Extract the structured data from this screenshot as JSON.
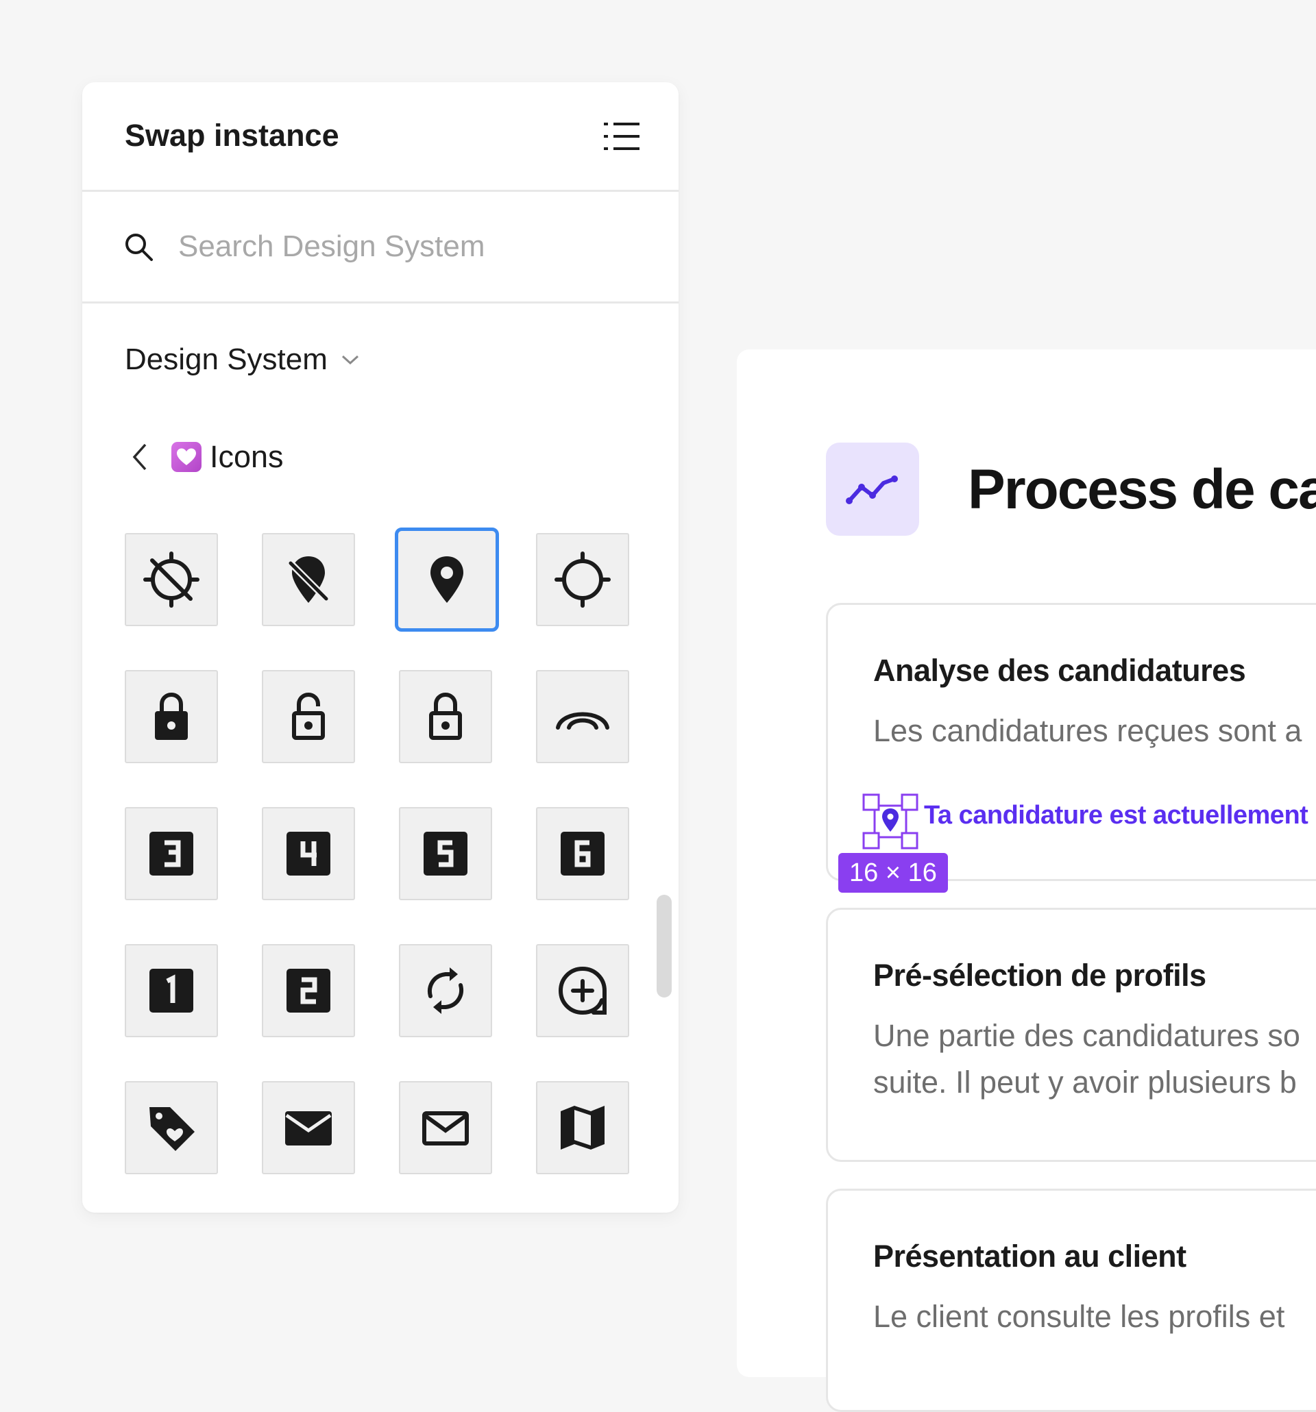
{
  "panel": {
    "title": "Swap instance",
    "list_view_icon": "list-view-icon",
    "search": {
      "icon": "search-icon",
      "placeholder": "Search Design System",
      "value": ""
    },
    "library": {
      "label": "Design System",
      "icon": "chevron-down-icon"
    },
    "category": {
      "back_icon": "chevron-left-icon",
      "emoji": "heart-emoji",
      "label": "Icons"
    },
    "icons": [
      [
        "location-disabled-icon",
        "location-off-icon",
        "location-pin-icon",
        "gps-target-icon"
      ],
      [
        "lock-icon",
        "lock-open-outline-icon",
        "lock-outline-icon",
        "signal-arc-icon"
      ],
      [
        "number-3-box-icon",
        "number-4-box-icon",
        "number-5-box-icon",
        "number-6-box-icon"
      ],
      [
        "number-1-box-icon",
        "number-2-box-icon",
        "sync-icon",
        "add-circle-icon"
      ],
      [
        "tag-heart-icon",
        "mail-filled-icon",
        "mail-outline-icon",
        "map-icon"
      ]
    ],
    "selected_icon": "location-pin-icon",
    "accent_color": "#3d8bf0"
  },
  "canvas": {
    "title": "Process de ca",
    "title_icon": "trending-line-icon",
    "steps": [
      {
        "title": "Analyse des candidatures",
        "description": "Les candidatures reçues sont a",
        "status": "Ta candidature est actuellement",
        "selection_size": "16 × 16"
      },
      {
        "title": "Pré-sélection de profils",
        "description_lines": [
          "Une partie des candidatures so",
          "suite. Il peut y avoir plusieurs b"
        ]
      },
      {
        "title": "Présentation au client",
        "description": "Le client consulte les profils et"
      }
    ],
    "accent_color": "#5a2ef0",
    "selection_color": "#8a3ff0"
  }
}
